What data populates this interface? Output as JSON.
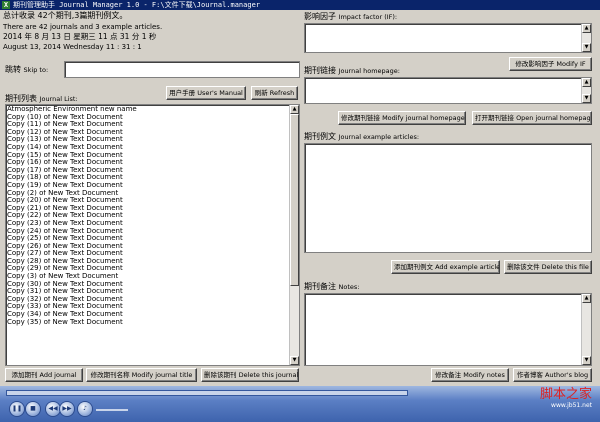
{
  "window": {
    "title": "期刊管理助手 Journal Manager 1.0 - F:\\文件下载\\Journal.manager",
    "icon_letter": "X"
  },
  "header": {
    "line1": "总计收录 42个期刊,3篇期刊例文。",
    "line2": "There are 42 journals and 3 example articles.",
    "line3": "2014 年 8 月 13 日 星期三 11 点 31 分 1 秒",
    "line4": "August 13, 2014 Wednesday 11 : 31 : 1"
  },
  "skip": {
    "label_cn": "跳转",
    "label_en": "Skip to:",
    "value": ""
  },
  "journal_list": {
    "label_cn": "期刊列表",
    "label_en": "Journal List:",
    "items": [
      "Atmospheric Environment new name",
      "Copy (10) of New Text Document",
      "Copy (11) of New Text Document",
      "Copy (12) of New Text Document",
      "Copy (13) of New Text Document",
      "Copy (14) of New Text Document",
      "Copy (15) of New Text Document",
      "Copy (16) of New Text Document",
      "Copy (17) of New Text Document",
      "Copy (18) of New Text Document",
      "Copy (19) of New Text Document",
      "Copy (2) of New Text Document",
      "Copy (20) of New Text Document",
      "Copy (21) of New Text Document",
      "Copy (22) of New Text Document",
      "Copy (23) of New Text Document",
      "Copy (24) of New Text Document",
      "Copy (25) of New Text Document",
      "Copy (26) of New Text Document",
      "Copy (27) of New Text Document",
      "Copy (28) of New Text Document",
      "Copy (29) of New Text Document",
      "Copy (3) of New Text Document",
      "Copy (30) of New Text Document",
      "Copy (31) of New Text Document",
      "Copy (32) of New Text Document",
      "Copy (33) of New Text Document",
      "Copy (34) of New Text Document",
      "Copy (35) of New Text Document"
    ]
  },
  "buttons": {
    "user_manual": "用户手册 User's Manual",
    "refresh": "刷新 Refresh",
    "add_journal": "添加期刊 Add journal",
    "modify_title": "修改期刊名称 Modify journal title",
    "delete_journal": "删除该期刊 Delete this journal",
    "modify_if": "修改影响因子 Modify IF",
    "modify_homepage": "修改期刊链接 Modify journal homepage",
    "open_homepage": "打开期刊链接 Open journal homepage",
    "add_example": "添加期刊例文 Add example article",
    "delete_file": "删除该文件 Delete this file",
    "modify_notes": "修改备注 Modify notes",
    "authors_blog": "作者博客 Author's blog"
  },
  "impact_factor": {
    "label_cn": "影响因子",
    "label_en": "Impact factor (IF):",
    "value": ""
  },
  "homepage": {
    "label_cn": "期刊链接",
    "label_en": "Journal homepage:",
    "value": ""
  },
  "examples": {
    "label_cn": "期刊例文",
    "label_en": "Journal example articles:"
  },
  "notes": {
    "label_cn": "期刊备注",
    "label_en": "Notes:",
    "value": ""
  },
  "player": {
    "icons": [
      "pause-icon",
      "stop-icon",
      "previous-icon",
      "next-icon",
      "volume-icon"
    ]
  },
  "watermark": {
    "main": "脚本之家",
    "sub": "www.jb51.net"
  }
}
